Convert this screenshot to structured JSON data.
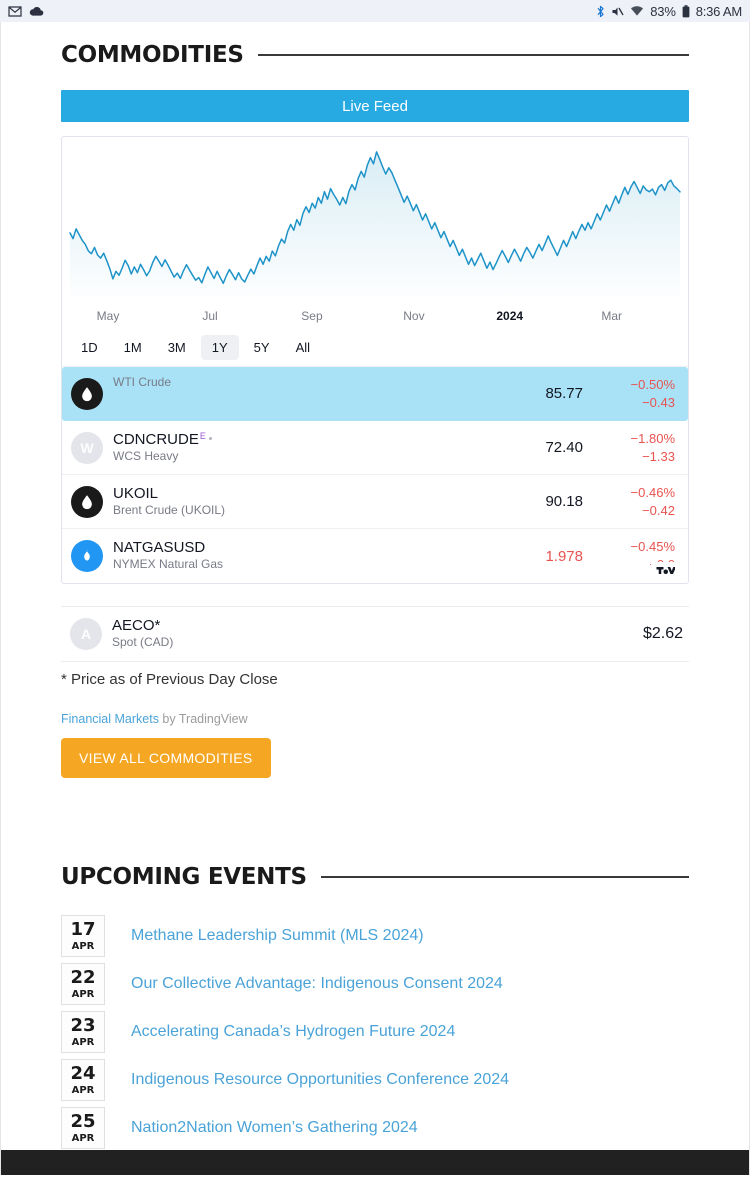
{
  "status_bar": {
    "left_icons": [
      "gmail-icon",
      "cloud-icon"
    ],
    "right_icons": [
      "bluetooth-icon",
      "mute-icon",
      "wifi-icon"
    ],
    "battery_percent": "83%",
    "time": "8:36 AM"
  },
  "commodities": {
    "title": "COMMODITIES",
    "live_feed_label": "Live Feed",
    "ranges": [
      {
        "label": "1D",
        "active": false
      },
      {
        "label": "1M",
        "active": false
      },
      {
        "label": "3M",
        "active": false
      },
      {
        "label": "1Y",
        "active": true
      },
      {
        "label": "5Y",
        "active": false
      },
      {
        "label": "All",
        "active": false
      }
    ],
    "quotes": [
      {
        "symbol": "",
        "description": "WTI Crude",
        "price": "85.77",
        "change_percent": "−0.50%",
        "change_abs": "−0.43",
        "icon": "oil-drop-icon",
        "icon_style": "black",
        "avatar_letter": "",
        "selected": true,
        "price_down": false,
        "exchange_sup": "",
        "has_dot": false
      },
      {
        "symbol": "CDNCRUDE",
        "description": "WCS Heavy",
        "price": "72.40",
        "change_percent": "−1.80%",
        "change_abs": "−1.33",
        "icon": "avatar-letter-icon",
        "icon_style": "gray",
        "avatar_letter": "W",
        "selected": false,
        "price_down": false,
        "exchange_sup": "E",
        "has_dot": true
      },
      {
        "symbol": "UKOIL",
        "description": "Brent Crude (UKOIL)",
        "price": "90.18",
        "change_percent": "−0.46%",
        "change_abs": "−0.42",
        "icon": "oil-drop-icon",
        "icon_style": "black",
        "avatar_letter": "",
        "selected": false,
        "price_down": false,
        "exchange_sup": "",
        "has_dot": false
      },
      {
        "symbol": "NATGASUSD",
        "description": "NYMEX Natural Gas",
        "price": "1.978",
        "change_percent": "−0.45%",
        "change_abs": "−0.0",
        "icon": "gas-flame-icon",
        "icon_style": "blue",
        "avatar_letter": "",
        "selected": false,
        "price_down": true,
        "exchange_sup": "",
        "has_dot": false
      }
    ],
    "extra_quote": {
      "symbol": "AECO*",
      "description": "Spot (CAD)",
      "price": "$2.62",
      "avatar_letter": "A"
    },
    "footnote": "* Price as of Previous Day Close",
    "attribution_link": "Financial Markets",
    "attribution_rest": " by TradingView",
    "cta_label": "VIEW ALL COMMODITIES",
    "tradingview_logo": "tradingview-logo-icon"
  },
  "events": {
    "title": "UPCOMING EVENTS",
    "items": [
      {
        "day": "17",
        "month": "APR",
        "title": "Methane Leadership Summit (MLS 2024)"
      },
      {
        "day": "22",
        "month": "APR",
        "title": "Our Collective Advantage: Indigenous Consent 2024"
      },
      {
        "day": "23",
        "month": "APR",
        "title": "Accelerating Canada’s Hydrogen Future 2024"
      },
      {
        "day": "24",
        "month": "APR",
        "title": "Indigenous Resource Opportunities Conference 2024"
      },
      {
        "day": "25",
        "month": "APR",
        "title": "Nation2Nation Women’s Gathering 2024"
      }
    ]
  },
  "colors": {
    "accent_blue": "#27aae1",
    "chart_line": "#1e93c8",
    "down_red": "#e8534f",
    "cta_orange": "#f5a623",
    "link_blue": "#4aa3d8",
    "selected_row": "#a9e2f7"
  },
  "chart_data": {
    "type": "line",
    "title": "",
    "xlabel": "",
    "ylabel": "",
    "grid": false,
    "legend": "none",
    "x_tick_labels": [
      "May",
      "Jul",
      "Sep",
      "Nov",
      "2024",
      "Mar"
    ],
    "x_tick_positions": [
      0.068,
      0.233,
      0.398,
      0.563,
      0.718,
      0.883
    ],
    "x_tick_bold": [
      false,
      false,
      false,
      false,
      true,
      false
    ],
    "ylim": [
      62,
      95
    ],
    "series": [
      {
        "name": "WTI Crude",
        "values": [
          76.5,
          75.2,
          77.4,
          76.1,
          74.8,
          73.9,
          72.4,
          71.8,
          73.2,
          71.5,
          70.8,
          71.9,
          70.2,
          68.4,
          66.1,
          67.8,
          66.9,
          68.5,
          70.3,
          69.1,
          67.2,
          68.8,
          67.5,
          69.4,
          68.2,
          66.8,
          67.9,
          69.8,
          71.2,
          70.1,
          68.9,
          70.4,
          69.2,
          67.8,
          66.5,
          67.4,
          66.2,
          67.9,
          69.3,
          68.1,
          66.9,
          65.8,
          66.4,
          65.2,
          67.1,
          68.8,
          67.5,
          66.2,
          67.8,
          66.4,
          65.1,
          66.8,
          68.2,
          67.1,
          65.9,
          67.5,
          66.1,
          65.4,
          66.9,
          68.3,
          67.2,
          69.1,
          70.8,
          69.4,
          71.2,
          70.1,
          72.4,
          71.3,
          73.5,
          75.1,
          74.2,
          76.8,
          78.4,
          77.1,
          79.5,
          78.2,
          80.9,
          82.4,
          81.1,
          83.2,
          82.1,
          84.5,
          83.2,
          85.8,
          84.1,
          86.5,
          85.2,
          84.1,
          82.8,
          84.5,
          83.1,
          85.9,
          87.4,
          86.2,
          88.8,
          90.4,
          89.1,
          91.8,
          93.5,
          92.1,
          94.8,
          93.2,
          91.4,
          89.8,
          91.2,
          90.1,
          88.4,
          86.8,
          85.1,
          83.4,
          84.8,
          83.2,
          81.5,
          82.9,
          81.2,
          79.4,
          80.8,
          79.1,
          77.4,
          78.8,
          77.1,
          75.4,
          76.8,
          75.1,
          73.4,
          74.8,
          73.1,
          71.4,
          72.8,
          71.1,
          69.4,
          70.8,
          69.1,
          70.5,
          71.9,
          70.2,
          68.5,
          69.9,
          68.2,
          69.6,
          71.1,
          72.5,
          71.2,
          69.8,
          71.4,
          72.8,
          71.5,
          70.1,
          71.8,
          73.2,
          72.1,
          70.8,
          72.4,
          73.9,
          72.5,
          74.1,
          75.8,
          74.2,
          72.8,
          71.4,
          73.1,
          74.8,
          73.4,
          75.1,
          76.8,
          75.2,
          76.9,
          78.4,
          77.1,
          78.8,
          77.4,
          79.1,
          80.8,
          79.4,
          81.1,
          82.8,
          81.4,
          83.1,
          84.8,
          83.2,
          85.1,
          86.8,
          85.2,
          86.9,
          88.1,
          86.8,
          85.4,
          87.1,
          86.2,
          85.8,
          86.4,
          85.1,
          86.8,
          87.4,
          86.1,
          87.8,
          88.4,
          87.1,
          86.5,
          85.77
        ]
      }
    ]
  }
}
